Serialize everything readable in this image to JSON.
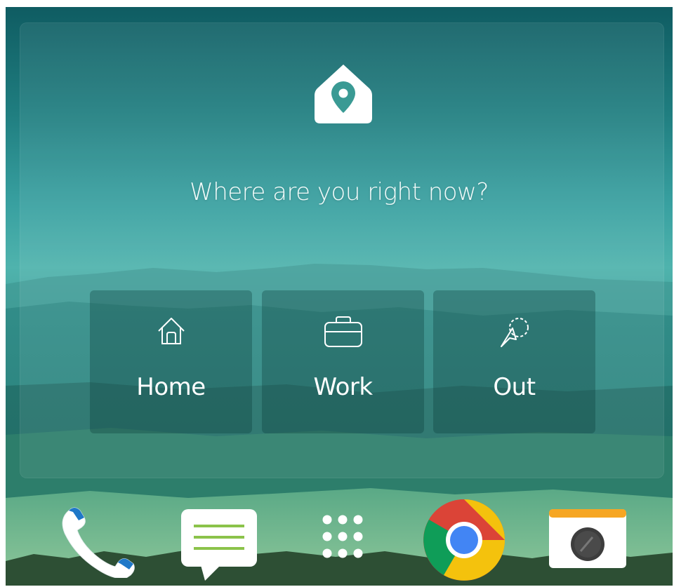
{
  "widget": {
    "question": "Where are you right now?",
    "locations": [
      {
        "label": "Home",
        "icon": "home-icon"
      },
      {
        "label": "Work",
        "icon": "briefcase-icon"
      },
      {
        "label": "Out",
        "icon": "navigation-arrow-icon"
      }
    ]
  },
  "dock": {
    "apps": [
      {
        "name": "Phone",
        "icon": "phone-icon"
      },
      {
        "name": "Messages",
        "icon": "message-icon"
      },
      {
        "name": "App drawer",
        "icon": "app-drawer-icon"
      },
      {
        "name": "Chrome",
        "icon": "chrome-icon"
      },
      {
        "name": "Camera",
        "icon": "camera-icon"
      }
    ]
  },
  "colors": {
    "accent": "#2f8f8a",
    "chrome_red": "#db4437",
    "chrome_yellow": "#f4c20d",
    "chrome_green": "#0f9d58",
    "chrome_blue": "#4285f4",
    "camera_orange": "#f6a623",
    "message_green": "#8bc34a"
  }
}
